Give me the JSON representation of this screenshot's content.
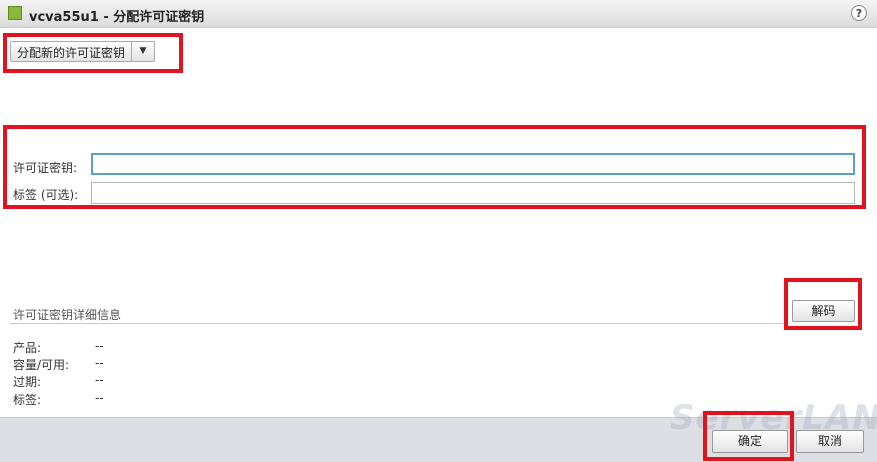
{
  "window": {
    "title": "vcva55u1 - 分配许可证密钥",
    "help": "?"
  },
  "assign": {
    "label": "分配新的许可证密钥",
    "arrow": "▼"
  },
  "form": {
    "license_key_label": "许可证密钥:",
    "license_key_value": "",
    "tag_label": "标签 (可选):",
    "tag_value": ""
  },
  "decode_label": "解码",
  "details": {
    "header": "许可证密钥详细信息",
    "rows": [
      {
        "label": "产品:",
        "value": "--"
      },
      {
        "label": "容量/可用:",
        "value": "--"
      },
      {
        "label": "过期:",
        "value": "--"
      },
      {
        "label": "标签:",
        "value": "--"
      }
    ]
  },
  "footer": {
    "ok_label": "确定",
    "cancel_label": "取消",
    "watermark": "ServerLAN"
  },
  "colors": {
    "highlight": "#e0141e",
    "focus_border": "#5aa0c8",
    "footer_bg": "#dcdfe3"
  }
}
